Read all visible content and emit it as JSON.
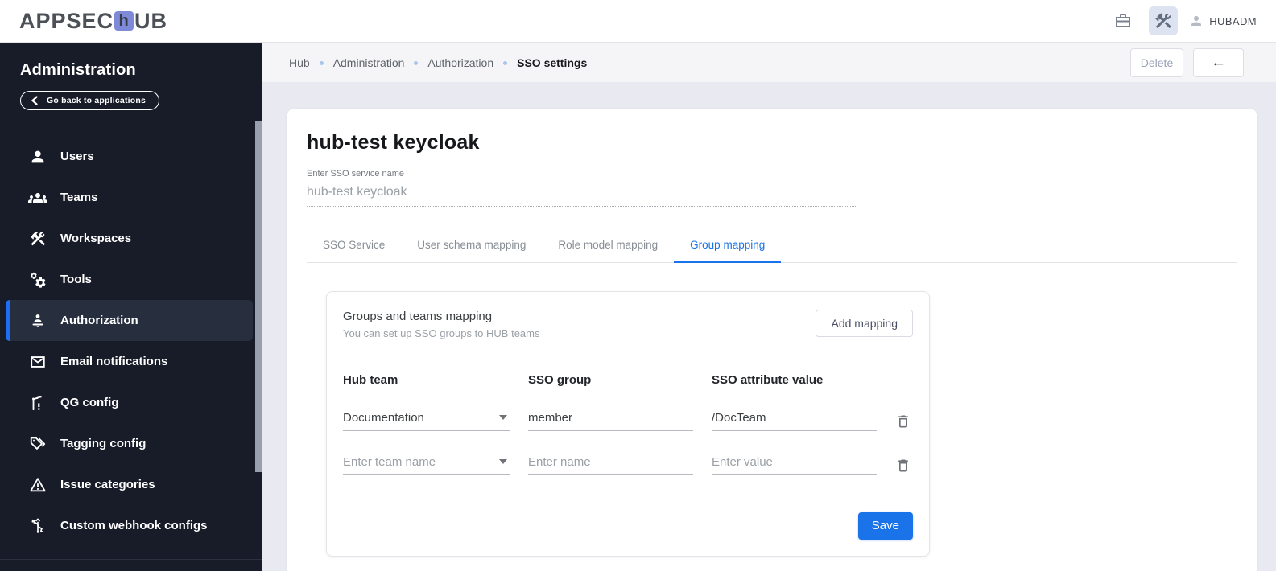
{
  "topbar": {
    "logo": {
      "pre": "APPSEC",
      "tile_letter": "h",
      "post": "UB"
    },
    "user_name": "HUBADM"
  },
  "breadcrumb": {
    "items": [
      "Hub",
      "Administration",
      "Authorization"
    ],
    "current": "SSO settings",
    "delete_label": "Delete",
    "back_arrow": "←"
  },
  "sidebar": {
    "title": "Administration",
    "back_button_label": "Go back to applications",
    "items": [
      {
        "label": "Users",
        "icon": "users-icon",
        "active": false
      },
      {
        "label": "Teams",
        "icon": "teams-icon",
        "active": false
      },
      {
        "label": "Workspaces",
        "icon": "workspaces-icon",
        "active": false
      },
      {
        "label": "Tools",
        "icon": "tools-icon",
        "active": false
      },
      {
        "label": "Authorization",
        "icon": "authorization-icon",
        "active": true
      },
      {
        "label": "Email notifications",
        "icon": "mail-icon",
        "active": false
      },
      {
        "label": "QG config",
        "icon": "quality-gate-icon",
        "active": false
      },
      {
        "label": "Tagging config",
        "icon": "tag-icon",
        "active": false
      },
      {
        "label": "Issue categories",
        "icon": "warning-icon",
        "active": false
      },
      {
        "label": "Custom webhook configs",
        "icon": "webhook-icon",
        "active": false
      }
    ]
  },
  "main": {
    "title": "hub-test keycloak",
    "service_name": {
      "label": "Enter SSO service name",
      "value": "hub-test keycloak"
    },
    "tabs": [
      {
        "label": "SSO Service",
        "active": false
      },
      {
        "label": "User schema mapping",
        "active": false
      },
      {
        "label": "Role model mapping",
        "active": false
      },
      {
        "label": "Group mapping",
        "active": true
      }
    ],
    "card": {
      "title": "Groups and teams mapping",
      "subtitle": "You can set up SSO groups to HUB teams",
      "add_button": "Add mapping",
      "columns": [
        "Hub team",
        "SSO group",
        "SSO attribute value"
      ],
      "rows": [
        {
          "hub_team": "Documentation",
          "sso_group": "member",
          "sso_attribute_value": "/DocTeam"
        },
        {
          "hub_team_placeholder": "Enter team name",
          "sso_group_placeholder": "Enter name",
          "sso_attribute_placeholder": "Enter value"
        }
      ],
      "save_button": "Save"
    }
  },
  "colors": {
    "accent_blue": "#1a73e8",
    "sidebar_bg": "#171c28",
    "sidebar_active_bg": "#272e3e",
    "sidebar_active_bar": "#1f6df2",
    "page_bg": "#e9eaf1",
    "breadcrumb_band_bg": "#f5f5f8",
    "logo_tile": "#7e8ad8",
    "breadcrumb_dot": "#a9c7ec"
  }
}
